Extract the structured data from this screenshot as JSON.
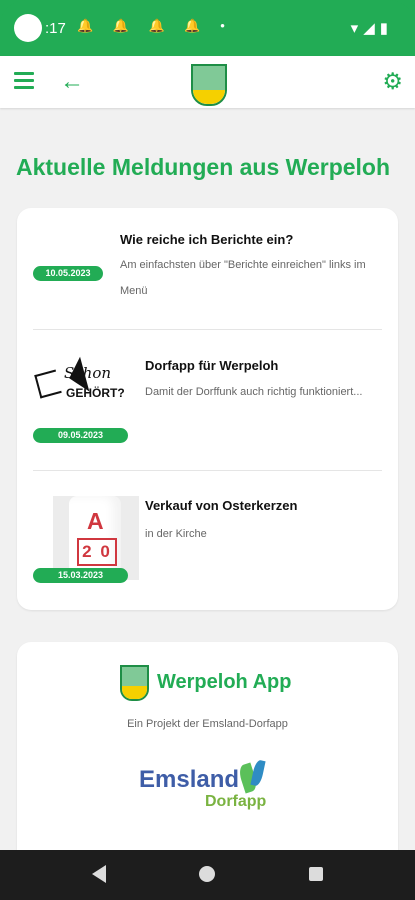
{
  "status_bar": {
    "time": ":17",
    "notifications": "🔔 🔔 🔔 🔔 •",
    "system_icons": "▾◢▮"
  },
  "header": {
    "menu_icon": "menu-icon",
    "back_icon": "arrow-left-icon",
    "gear_icon": "gear-icon"
  },
  "page": {
    "title": "Aktuelle Meldungen aus Werpeloh"
  },
  "news": [
    {
      "date": "10.05.2023",
      "title": "Wie reiche ich Berichte ein?",
      "description": "Am einfachsten über \"Berichte einreichen\" links im Menü"
    },
    {
      "date": "09.05.2023",
      "title": "Dorfapp für Werpeloh",
      "description": "Damit der Dorffunk auch richtig funktioniert...",
      "thumb_text_1": "Schon",
      "thumb_text_2": "GEHÖRT?"
    },
    {
      "date": "15.03.2023",
      "title": "Verkauf von Osterkerzen",
      "description": "in der Kirche",
      "candle_letter": "A",
      "candle_numbers": "2 0"
    }
  ],
  "promo": {
    "title": "Werpeloh App",
    "subtitle": "Ein Projekt der Emsland-Dorfapp",
    "brand_main": "Emsland",
    "brand_sub": "Dorfapp"
  },
  "colors": {
    "primary": "#22ac55",
    "text": "#111111",
    "muted": "#666666"
  }
}
